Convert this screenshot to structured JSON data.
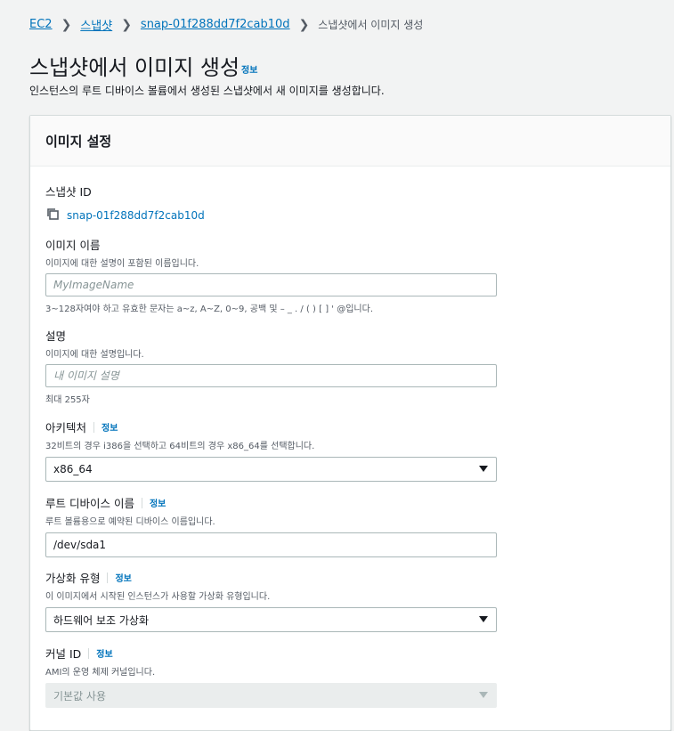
{
  "breadcrumb": {
    "items": [
      "EC2",
      "스냅샷",
      "snap-01f288dd7f2cab10d"
    ],
    "current": "스냅샷에서 이미지 생성"
  },
  "page": {
    "title": "스냅샷에서 이미지 생성",
    "info": "정보",
    "description": "인스턴스의 루트 디바이스 볼륨에서 생성된 스냅샷에서 새 이미지를 생성합니다."
  },
  "panel": {
    "title": "이미지 설정"
  },
  "snapshot": {
    "label": "스냅샷 ID",
    "value": "snap-01f288dd7f2cab10d",
    "icon": "copy-icon"
  },
  "image_name": {
    "label": "이미지 이름",
    "hint": "이미지에 대한 설명이 포함된 이름입니다.",
    "placeholder": "MyImageName",
    "value": "",
    "constraint": "3~128자여야 하고 유효한 문자는 a~z, A~Z, 0~9, 공백 및 – _ . / ( ) [ ] ' @입니다."
  },
  "description": {
    "label": "설명",
    "hint": "이미지에 대한 설명입니다.",
    "placeholder": "내 이미지 설명",
    "value": "",
    "constraint": "최대 255자"
  },
  "architecture": {
    "label": "아키텍처",
    "info": "정보",
    "hint": "32비트의 경우 i386을 선택하고 64비트의 경우 x86_64를 선택합니다.",
    "selected": "x86_64"
  },
  "root_device": {
    "label": "루트 디바이스 이름",
    "info": "정보",
    "hint": "루트 볼륨용으로 예약된 디바이스 이름입니다.",
    "value": "/dev/sda1"
  },
  "virtualization": {
    "label": "가상화 유형",
    "info": "정보",
    "hint": "이 이미지에서 시작된 인스턴스가 사용할 가상화 유형입니다.",
    "selected": "하드웨어 보조 가상화"
  },
  "kernel": {
    "label": "커널 ID",
    "info": "정보",
    "hint": "AMI의 운영 체제 커널입니다.",
    "selected": "기본값 사용"
  },
  "colors": {
    "link": "#0073bb",
    "background": "#f2f3f3",
    "text": "#16191f"
  }
}
